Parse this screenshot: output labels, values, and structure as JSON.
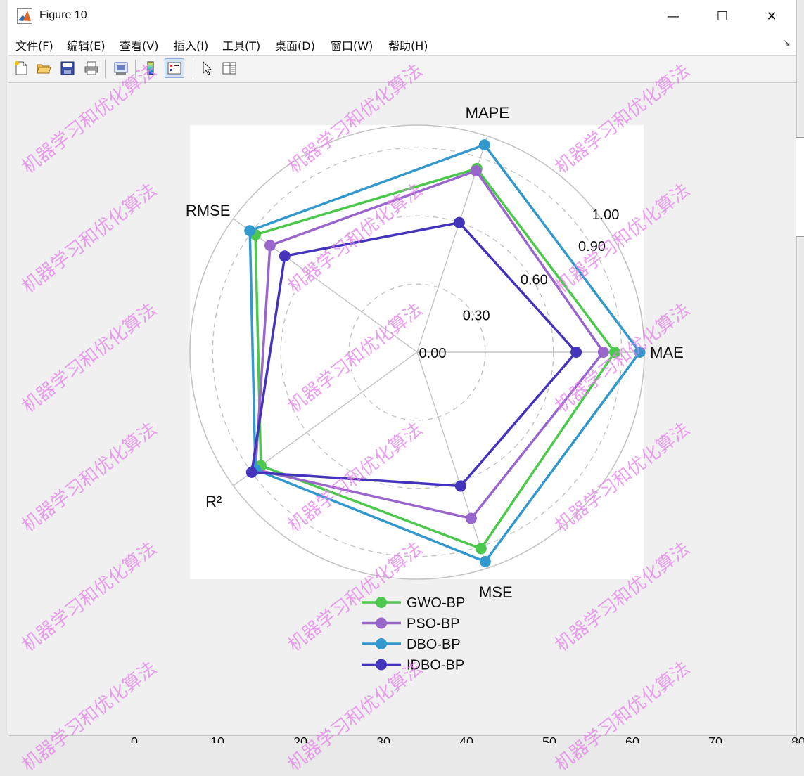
{
  "window": {
    "title": "Figure 10",
    "controls": {
      "minimize": "—",
      "maximize": "☐",
      "close": "✕"
    }
  },
  "menu": {
    "items": [
      "文件(F)",
      "编辑(E)",
      "查看(V)",
      "插入(I)",
      "工具(T)",
      "桌面(D)",
      "窗口(W)",
      "帮助(H)"
    ],
    "dock_arrow": "↘"
  },
  "toolbar": {
    "buttons": [
      "new-figure-icon",
      "open-file-icon",
      "save-icon",
      "print-icon",
      "print-preview-icon",
      "colorbar-icon",
      "legend-icon",
      "pointer-icon",
      "property-inspector-icon"
    ],
    "active": "legend-icon"
  },
  "colors": {
    "GWO-BP": "#4cc94c",
    "PSO-BP": "#9966cc",
    "DBO-BP": "#3399cc",
    "IDBO-BP": "#4433bb",
    "grid": "#c4c4c4",
    "watermark": "#e480ea"
  },
  "chart_data": {
    "type": "radar",
    "title": "",
    "axes": [
      "MAPE",
      "RMSE",
      "R²",
      "MSE",
      "MAE"
    ],
    "radial_ticks": [
      0.0,
      0.3,
      0.6,
      0.9,
      1.0
    ],
    "radial_tick_labels": [
      "0.00",
      "0.30",
      "0.60",
      "0.90",
      "1.00"
    ],
    "rlim": [
      0,
      1.0
    ],
    "grid": true,
    "legend_position": "bottom",
    "series": [
      {
        "name": "GWO-BP",
        "values": [
          0.85,
          0.88,
          0.85,
          0.91,
          0.87
        ]
      },
      {
        "name": "PSO-BP",
        "values": [
          0.84,
          0.8,
          0.88,
          0.77,
          0.82
        ]
      },
      {
        "name": "DBO-BP",
        "values": [
          0.96,
          0.91,
          0.88,
          0.97,
          0.98
        ]
      },
      {
        "name": "IDBO-BP",
        "values": [
          0.6,
          0.72,
          0.9,
          0.62,
          0.7
        ]
      }
    ]
  },
  "watermark_text": "机器学习和优化算法",
  "background_axis_ticks": [
    "0",
    "10",
    "20",
    "30",
    "40",
    "50",
    "60",
    "70",
    "80"
  ]
}
